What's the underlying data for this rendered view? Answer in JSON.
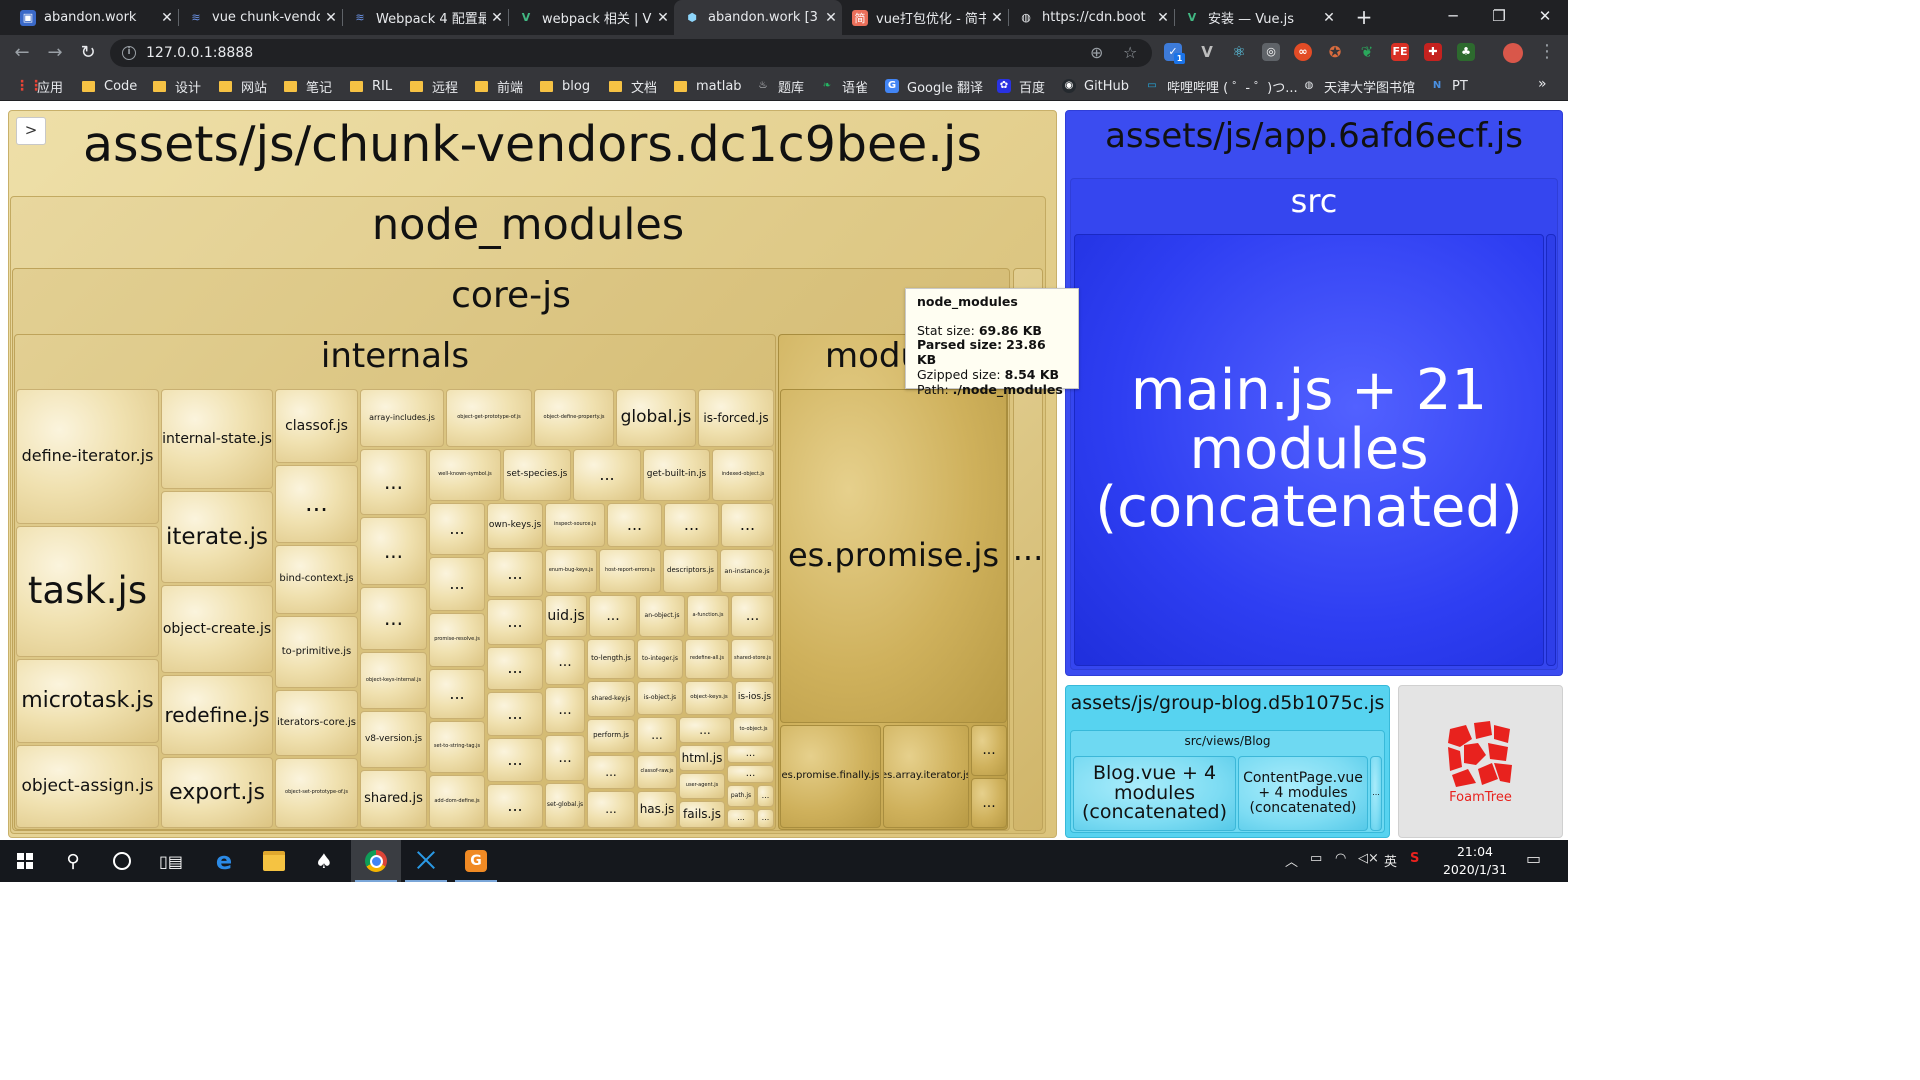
{
  "browser": {
    "tabs": [
      {
        "title": "abandon.work",
        "favicon": "blog-favicon",
        "color": "#4285f4"
      },
      {
        "title": "vue chunk-vendo",
        "favicon": "segmentfault-favicon",
        "color": "#4a7ad9"
      },
      {
        "title": "Webpack 4 配置最",
        "favicon": "segmentfault-favicon",
        "color": "#4a7ad9"
      },
      {
        "title": "webpack 相关 | V",
        "favicon": "vue-favicon",
        "color": "#42b883"
      },
      {
        "title": "abandon.work [3",
        "favicon": "webpack-favicon",
        "color": "#8ed6fb"
      },
      {
        "title": "vue打包优化 - 简书",
        "favicon": "jianshu-favicon",
        "color": "#ea6f5a"
      },
      {
        "title": "https://cdn.boot",
        "favicon": "globe-icon",
        "color": "#9aa0a6"
      },
      {
        "title": "安装 — Vue.js",
        "favicon": "vue-favicon",
        "color": "#42b883"
      }
    ],
    "active_tab_index": 4,
    "new_tab": "+",
    "window_controls": {
      "minimize": "─",
      "restore": "❐",
      "close": "✕"
    },
    "url": "127.0.0.1:8888",
    "nav": {
      "back": "←",
      "forward": "→",
      "reload": "↻"
    },
    "extension_badge": "1",
    "bookmarks": [
      {
        "label": "应用",
        "kind": "apps"
      },
      {
        "label": "Code",
        "kind": "folder"
      },
      {
        "label": "设计",
        "kind": "folder"
      },
      {
        "label": "网站",
        "kind": "folder"
      },
      {
        "label": "笔记",
        "kind": "folder"
      },
      {
        "label": "RIL",
        "kind": "folder"
      },
      {
        "label": "远程",
        "kind": "folder"
      },
      {
        "label": "前端",
        "kind": "folder"
      },
      {
        "label": "blog",
        "kind": "folder"
      },
      {
        "label": "文档",
        "kind": "folder"
      },
      {
        "label": "matlab",
        "kind": "folder"
      },
      {
        "label": "题库",
        "kind": "site"
      },
      {
        "label": "语雀",
        "kind": "site"
      },
      {
        "label": "Google 翻译",
        "kind": "site"
      },
      {
        "label": "百度",
        "kind": "site"
      },
      {
        "label": "GitHub",
        "kind": "site"
      },
      {
        "label": "哔哩哔哩 ( ゜- ゜)つ...",
        "kind": "site"
      },
      {
        "label": "天津大学图书馆",
        "kind": "site"
      },
      {
        "label": "PT",
        "kind": "site"
      }
    ],
    "bookmarks_more": "»"
  },
  "treemap": {
    "sidebar_toggle": ">",
    "vendors": {
      "title": "assets/js/chunk-vendors.dc1c9bee.js",
      "node_modules": "node_modules",
      "corejs": "core-js",
      "internals": "internals",
      "modules_label": "modu",
      "es_promise": "es.promise.js",
      "es_promise_finally": "es.promise.finally.js",
      "es_array_iterator": "es.array.iterator.js",
      "side_more": "...",
      "internals_files": {
        "define_iterator": "define-iterator.js",
        "task": "task.js",
        "microtask": "microtask.js",
        "object_assign": "object-assign.js",
        "internal_state": "internal-state.js",
        "iterate": "iterate.js",
        "object_create": "object-create.js",
        "redefine": "redefine.js",
        "export": "export.js",
        "classof": "classof.js",
        "bind_context": "bind-context.js",
        "to_primitive": "to-primitive.js",
        "iterators_core": "iterators-core.js",
        "object_set_prototype_of": "object-set-prototype-of.js",
        "array_includes": "array-includes.js",
        "object_get_prototype_of": "object-get-prototype-of.js",
        "object_define_property": "object-define-property.js",
        "global": "global.js",
        "is_forced": "is-forced.js",
        "well_known_symbol": "well-known-symbol.js",
        "set_species": "set-species.js",
        "get_built_in": "get-built-in.js",
        "indexed_object": "indexed-object.js",
        "own_keys": "own-keys.js",
        "inspect_source": "inspect-source.js",
        "enum_bug_keys": "enum-bug-keys.js",
        "host_report_errors": "host-report-errors.js",
        "descriptors": "descriptors.js",
        "an_instance": "an-instance.js",
        "uid": "uid.js",
        "an_object": "an-object.js",
        "a_function": "a-function.js",
        "to_length": "to-length.js",
        "to_integer": "to-integer.js",
        "redefine_all": "redefine-all.js",
        "shared_store": "shared-store.js",
        "shared_key": "shared-key.js",
        "is_object": "is-object.js",
        "object_keys": "object-keys.js",
        "is_ios": "is-ios.js",
        "to_object": "to-object.js",
        "perform": "perform.js",
        "html": "html.js",
        "classof_raw": "classof-raw.js",
        "user_agent": "user-agent.js",
        "path": "path.js",
        "has": "has.js",
        "fails": "fails.js",
        "promise_resolve": "promise-resolve.js",
        "object_keys_internal": "object-keys-internal.js",
        "v8_version": "v8-version.js",
        "set_to_string_tag": "set-to-string-tag.js",
        "shared": "shared.js",
        "set_global": "set-global.js",
        "add_dom_define": "add-dom-define.js",
        "ellipsis": "..."
      }
    },
    "app": {
      "title": "assets/js/app.6afd6ecf.js",
      "src": "src",
      "main": "main.js + 21 modules (concatenated)"
    },
    "blog": {
      "title": "assets/js/group-blog.d5b1075c.js",
      "views": "src/views/Blog",
      "blog_vue": "Blog.vue + 4 modules (concatenated)",
      "content_page": "ContentPage.vue + 4 modules (concatenated)",
      "more": "..."
    },
    "foamtree": {
      "label": "FoamTree",
      "color": "#e8221e"
    },
    "tooltip": {
      "title": "node_modules",
      "stat_label": "Stat size:",
      "stat_value": "69.86 KB",
      "parsed_label": "Parsed size:",
      "parsed_value": "23.86 KB",
      "gzip_label": "Gzipped size:",
      "gzip_value": "8.54 KB",
      "path_label": "Path:",
      "path_value": "./node_modules"
    },
    "colors": {
      "vendors": "#e4cf8e",
      "app": "#3b4cf0",
      "blog": "#57d3f0"
    }
  },
  "taskbar": {
    "apps": [
      "windows-start-icon",
      "search-icon",
      "cortana-icon",
      "task-view-icon",
      "edge-icon",
      "file-explorer-icon",
      "solitaire-icon",
      "chrome-icon",
      "vscode-icon",
      "mindmaster-icon"
    ],
    "active_app": "chrome-icon",
    "tray": {
      "ime": "英",
      "time": "21:04",
      "date": "2020/1/31"
    }
  }
}
